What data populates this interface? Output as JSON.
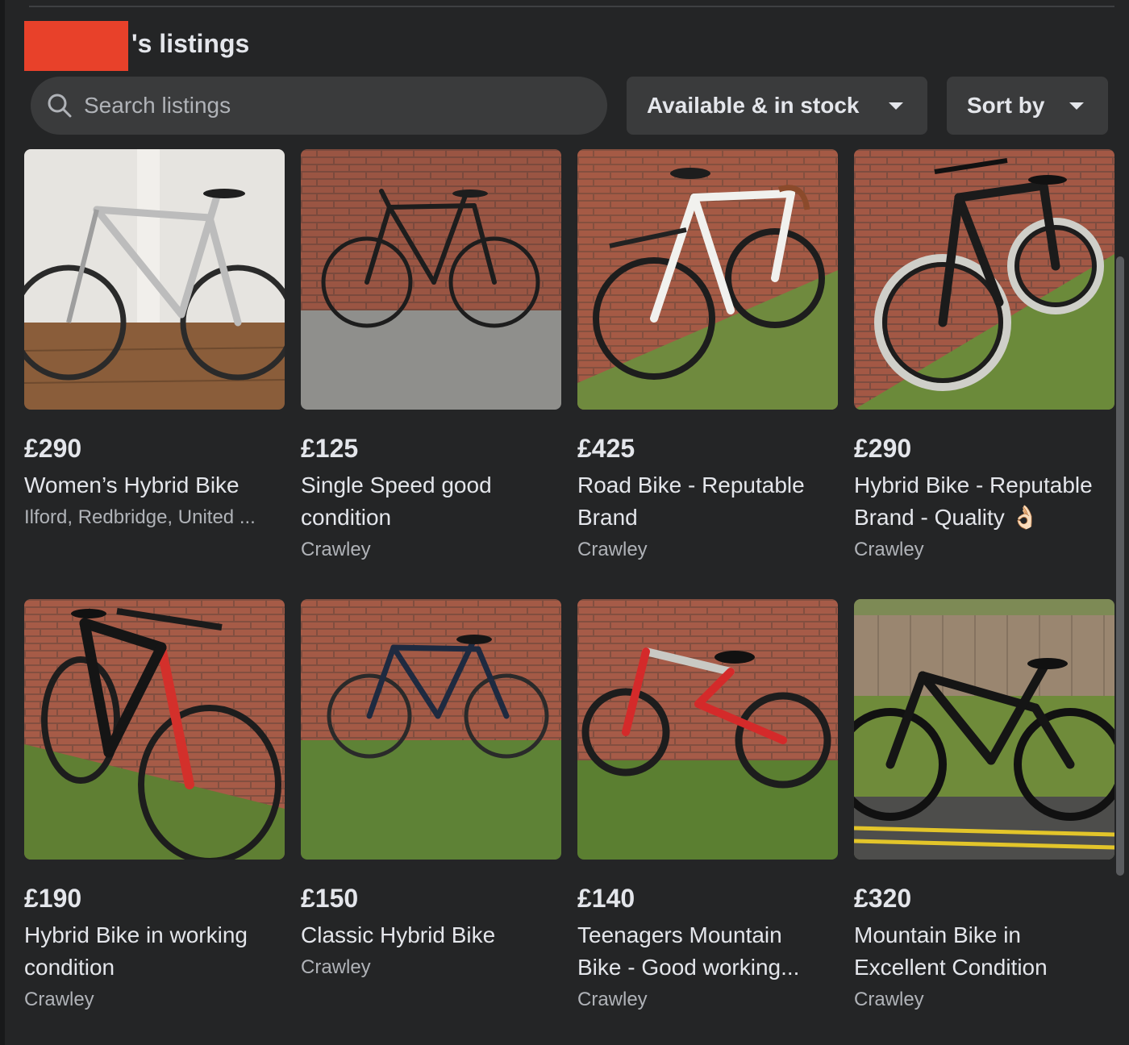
{
  "header": {
    "title_suffix": "'s listings"
  },
  "search": {
    "placeholder": "Search listings"
  },
  "filters": {
    "availability": "Available & in stock",
    "sort": "Sort by"
  },
  "listings": [
    {
      "price": "£290",
      "title_1": "Women’s Hybrid Bike",
      "title_2": "",
      "location": "Ilford, Redbridge, United ..."
    },
    {
      "price": "£125",
      "title_1": "Single Speed good",
      "title_2": "condition",
      "location": "Crawley"
    },
    {
      "price": "£425",
      "title_1": "Road Bike - Reputable",
      "title_2": "Brand",
      "location": "Crawley"
    },
    {
      "price": "£290",
      "title_1": "Hybrid Bike - Reputable",
      "title_2": "Brand - Quality 👌🏻",
      "location": "Crawley"
    },
    {
      "price": "£190",
      "title_1": "Hybrid Bike in working",
      "title_2": "condition",
      "location": "Crawley"
    },
    {
      "price": "£150",
      "title_1": "Classic Hybrid Bike",
      "title_2": "",
      "location": "Crawley"
    },
    {
      "price": "£140",
      "title_1": "Teenagers Mountain",
      "title_2": "Bike - Good working...",
      "location": "Crawley"
    },
    {
      "price": "£320",
      "title_1": "Mountain Bike in",
      "title_2": "Excellent Condition",
      "location": "Crawley"
    }
  ]
}
